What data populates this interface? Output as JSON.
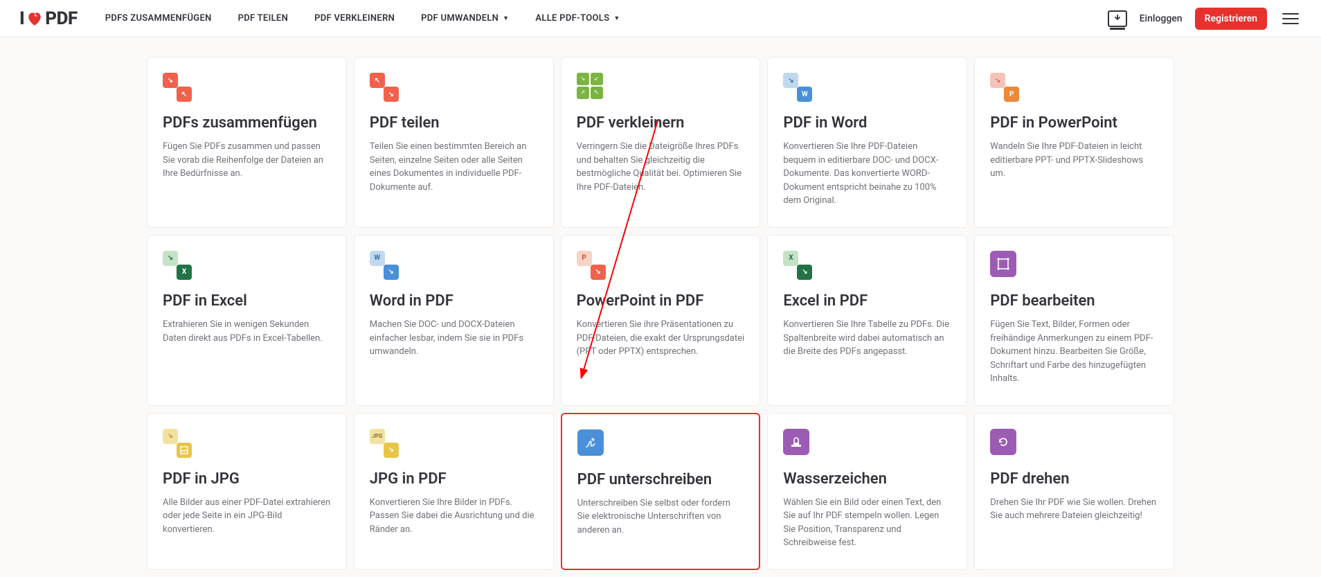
{
  "header": {
    "logo_part1": "I",
    "logo_part2": "PDF",
    "nav": [
      {
        "label": "PDFS ZUSAMMENFÜGEN",
        "dropdown": false
      },
      {
        "label": "PDF TEILEN",
        "dropdown": false
      },
      {
        "label": "PDF VERKLEINERN",
        "dropdown": false
      },
      {
        "label": "PDF UMWANDELN",
        "dropdown": true
      },
      {
        "label": "ALLE PDF-TOOLS",
        "dropdown": true
      }
    ],
    "login": "Einloggen",
    "register": "Registrieren"
  },
  "tools": [
    {
      "key": "merge",
      "title": "PDFs zusammenfügen",
      "desc": "Fügen Sie PDFs zusammen und passen Sie vorab die Reihenfolge der Dateien an Ihre Bedürfnisse an."
    },
    {
      "key": "split",
      "title": "PDF teilen",
      "desc": "Teilen Sie einen bestimmten Bereich an Seiten, einzelne Seiten oder alle Seiten eines Dokumentes in individuelle PDF-Dokumente auf."
    },
    {
      "key": "compress",
      "title": "PDF verkleinern",
      "desc": "Verringern Sie die Dateigröße Ihres PDFs und behalten Sie gleichzeitig die bestmögliche Qualität bei. Optimieren Sie Ihre PDF-Dateien."
    },
    {
      "key": "pdf2word",
      "title": "PDF in Word",
      "desc": "Konvertieren Sie Ihre PDF-Dateien bequem in editierbare DOC- und DOCX-Dokumente. Das konvertierte WORD-Dokument entspricht beinahe zu 100% dem Original."
    },
    {
      "key": "pdf2ppt",
      "title": "PDF in PowerPoint",
      "desc": "Wandeln Sie Ihre PDF-Dateien in leicht editierbare PPT- und PPTX-Slideshows um."
    },
    {
      "key": "pdf2excel",
      "title": "PDF in Excel",
      "desc": "Extrahieren Sie in wenigen Sekunden Daten direkt aus PDFs in Excel-Tabellen."
    },
    {
      "key": "word2pdf",
      "title": "Word in PDF",
      "desc": "Machen Sie DOC- und DOCX-Dateien einfacher lesbar, indem Sie sie in PDFs umwandeln."
    },
    {
      "key": "ppt2pdf",
      "title": "PowerPoint in PDF",
      "desc": "Konvertieren Sie ihre Präsentationen zu PDF-Dateien, die exakt der Ursprungsdatei (PPT oder PPTX) entsprechen."
    },
    {
      "key": "excel2pdf",
      "title": "Excel in PDF",
      "desc": "Konvertieren Sie Ihre Tabelle zu PDFs. Die Spaltenbreite wird dabei automatisch an die Breite des PDFs angepasst."
    },
    {
      "key": "edit",
      "title": "PDF bearbeiten",
      "desc": "Fügen Sie Text, Bilder, Formen oder freihändige Anmerkungen zu einem PDF-Dokument hinzu. Bearbeiten Sie Größe, Schriftart und Farbe des hinzugefügten Inhalts."
    },
    {
      "key": "pdf2jpg",
      "title": "PDF in JPG",
      "desc": "Alle Bilder aus einer PDF-Datei extrahieren oder jede Seite in ein JPG-Bild konvertieren."
    },
    {
      "key": "jpg2pdf",
      "title": "JPG in PDF",
      "desc": "Konvertieren Sie Ihre Bilder in PDFs. Passen Sie dabei die Ausrichtung und die Ränder an."
    },
    {
      "key": "sign",
      "title": "PDF unterschreiben",
      "desc": "Unterschreiben Sie selbst oder fordern Sie elektronische Unterschriften von anderen an.",
      "highlighted": true
    },
    {
      "key": "watermark",
      "title": "Wasserzeichen",
      "desc": "Wählen Sie ein Bild oder einen Text, den Sie auf Ihr PDF stempeln wollen. Legen Sie Position, Transparenz und Schreibweise fest."
    },
    {
      "key": "rotate",
      "title": "PDF drehen",
      "desc": "Drehen Sie Ihr PDF wie Sie wollen. Drehen Sie auch mehrere Dateien gleichzeitig!"
    }
  ]
}
